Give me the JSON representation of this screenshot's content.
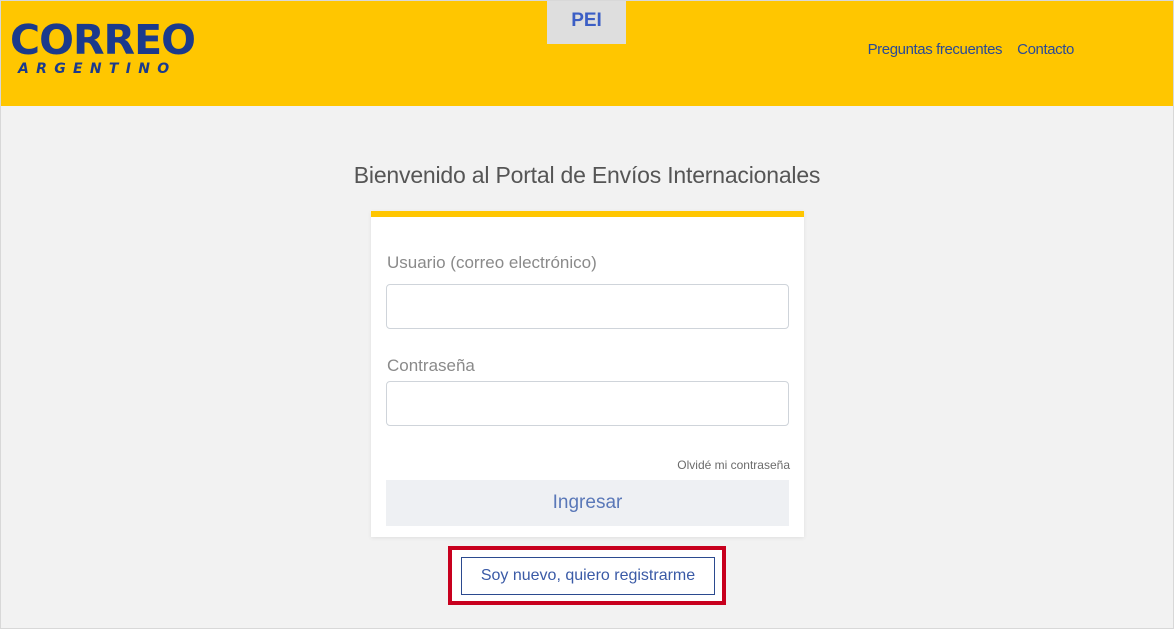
{
  "header": {
    "logo_text": "CORREO",
    "logo_subtext": "ARGENTINO",
    "app_tab": "PEI",
    "nav": [
      {
        "label": "Preguntas frecuentes"
      },
      {
        "label": "Contacto"
      }
    ]
  },
  "main": {
    "welcome": "Bienvenido al Portal de Envíos Internacionales"
  },
  "login": {
    "user_label": "Usuario (correo electrónico)",
    "user_value": "",
    "password_label": "Contraseña",
    "password_value": "",
    "forgot_link": "Olvidé mi contraseña",
    "submit_label": "Ingresar"
  },
  "register": {
    "label": "Soy nuevo, quiero registrarme",
    "highlight_color": "#c8001e"
  },
  "colors": {
    "header_bg": "#ffc600",
    "brand_blue": "#1b3a8c",
    "page_bg": "#f2f2f2"
  }
}
